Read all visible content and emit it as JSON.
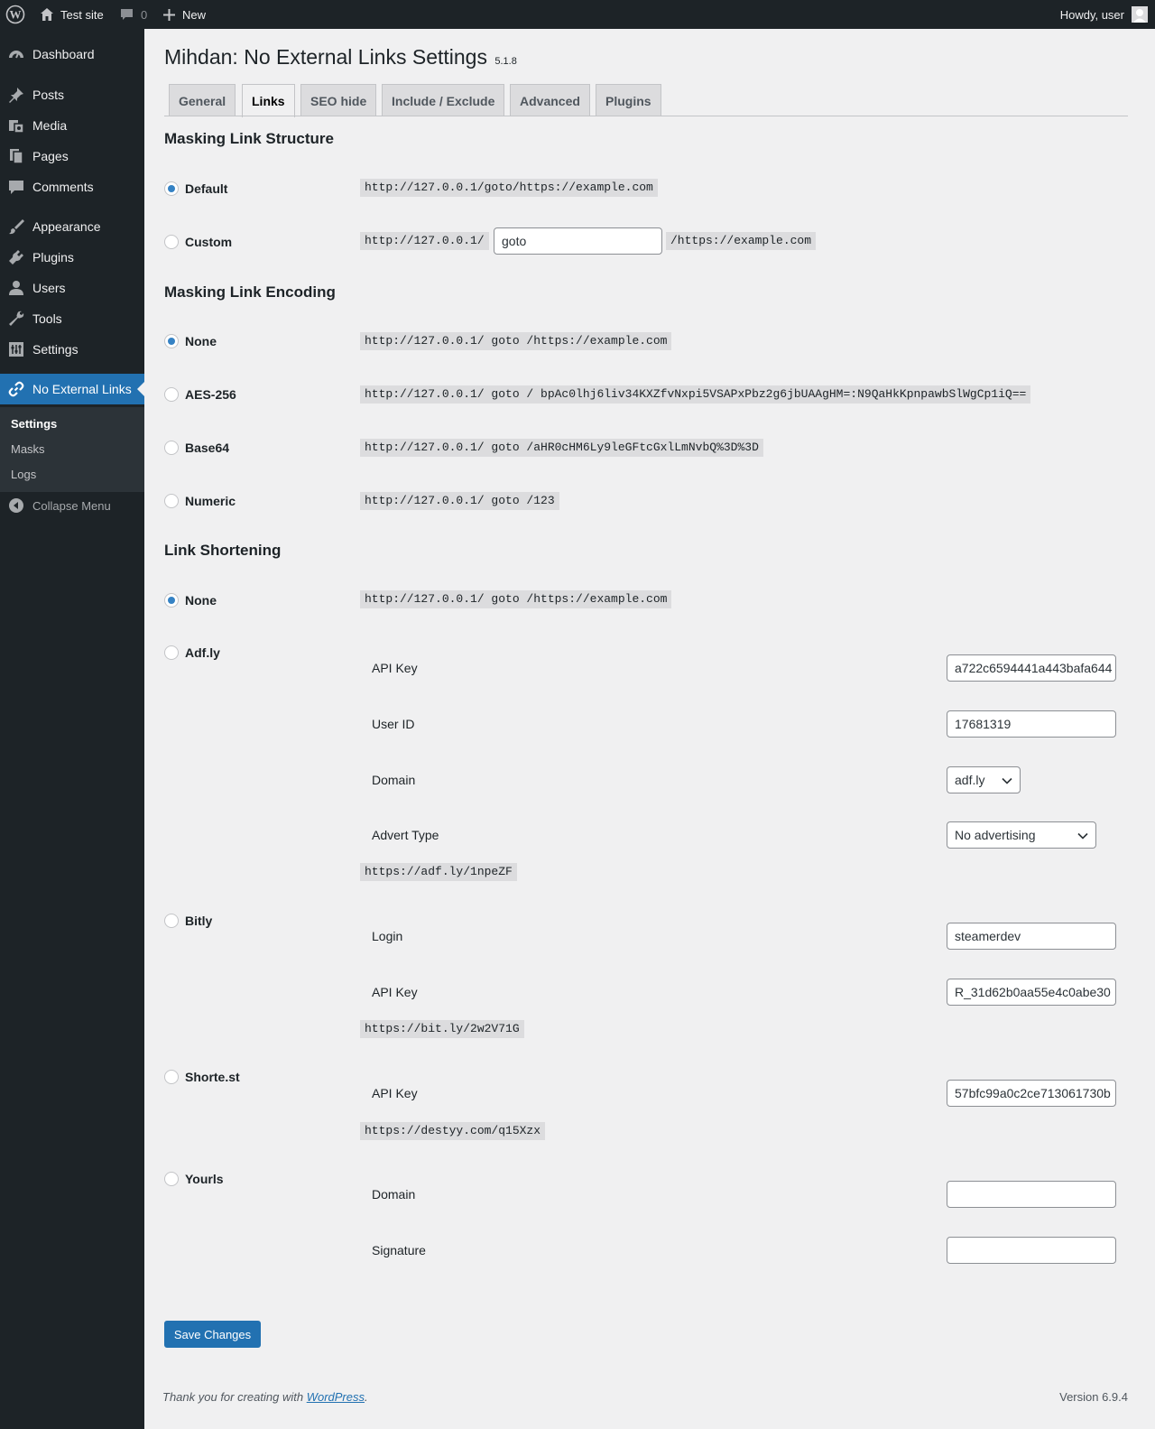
{
  "adminbar": {
    "site_name": "Test site",
    "comments_count": "0",
    "new_label": "New",
    "howdy": "Howdy, user"
  },
  "sidebar": {
    "items": [
      {
        "label": "Dashboard",
        "icon": "dashboard-icon"
      },
      {
        "label": "Posts",
        "icon": "pin-icon"
      },
      {
        "label": "Media",
        "icon": "media-icon"
      },
      {
        "label": "Pages",
        "icon": "pages-icon"
      },
      {
        "label": "Comments",
        "icon": "comment-icon"
      },
      {
        "label": "Appearance",
        "icon": "brush-icon"
      },
      {
        "label": "Plugins",
        "icon": "plug-icon"
      },
      {
        "label": "Users",
        "icon": "user-icon"
      },
      {
        "label": "Tools",
        "icon": "wrench-icon"
      },
      {
        "label": "Settings",
        "icon": "settings-icon"
      },
      {
        "label": "No External Links",
        "icon": "link-icon"
      }
    ],
    "submenu": [
      "Settings",
      "Masks",
      "Logs"
    ],
    "collapse": "Collapse Menu"
  },
  "page": {
    "title": "Mihdan: No External Links Settings",
    "version": "5.1.8"
  },
  "tabs": [
    "General",
    "Links",
    "SEO hide",
    "Include / Exclude",
    "Advanced",
    "Plugins"
  ],
  "structure": {
    "heading": "Masking Link Structure",
    "default_label": "Default",
    "default_example": "http://127.0.0.1/goto/https://example.com",
    "custom_label": "Custom",
    "custom_prefix": "http://127.0.0.1/",
    "custom_value": "goto",
    "custom_suffix": "/https://example.com"
  },
  "encoding": {
    "heading": "Masking Link Encoding",
    "options": [
      {
        "label": "None",
        "example": "http://127.0.0.1/ goto /https://example.com",
        "checked": true
      },
      {
        "label": "AES-256",
        "example": "http://127.0.0.1/ goto / bpAc0lhj6liv34KXZfvNxpi5VSAPxPbz2g6jbUAAgHM=:N9QaHkKpnpawbSlWgCp1iQ==",
        "checked": false
      },
      {
        "label": "Base64",
        "example": "http://127.0.0.1/ goto /aHR0cHM6Ly9leGFtcGxlLmNvbQ%3D%3D",
        "checked": false
      },
      {
        "label": "Numeric",
        "example": "http://127.0.0.1/ goto /123",
        "checked": false
      }
    ]
  },
  "shortening": {
    "heading": "Link Shortening",
    "none_label": "None",
    "none_example": "http://127.0.0.1/ goto /https://example.com",
    "adfly": {
      "label": "Adf.ly",
      "api_key_label": "API Key",
      "api_key": "a722c6594441a443bafa644",
      "user_id_label": "User ID",
      "user_id": "17681319",
      "domain_label": "Domain",
      "domain": "adf.ly",
      "advert_label": "Advert Type",
      "advert": "No advertising",
      "example": "https://adf.ly/1npeZF"
    },
    "bitly": {
      "label": "Bitly",
      "login_label": "Login",
      "login": "steamerdev",
      "api_key_label": "API Key",
      "api_key": "R_31d62b0aa55e4c0abe30",
      "example": "https://bit.ly/2w2V71G"
    },
    "shortest": {
      "label": "Shorte.st",
      "api_key_label": "API Key",
      "api_key": "57bfc99a0c2ce713061730b",
      "example": "https://destyy.com/q15Xzx"
    },
    "yourls": {
      "label": "Yourls",
      "domain_label": "Domain",
      "domain": "",
      "signature_label": "Signature",
      "signature": ""
    }
  },
  "save_label": "Save Changes",
  "footer": {
    "thanks_pre": "Thank you for creating with ",
    "wp_link": "WordPress",
    "thanks_post": ".",
    "version": "Version 6.9.4"
  },
  "colors": {
    "adminbar_bg": "#1d2327",
    "accent": "#2271b1",
    "page_bg": "#f0f0f1"
  }
}
